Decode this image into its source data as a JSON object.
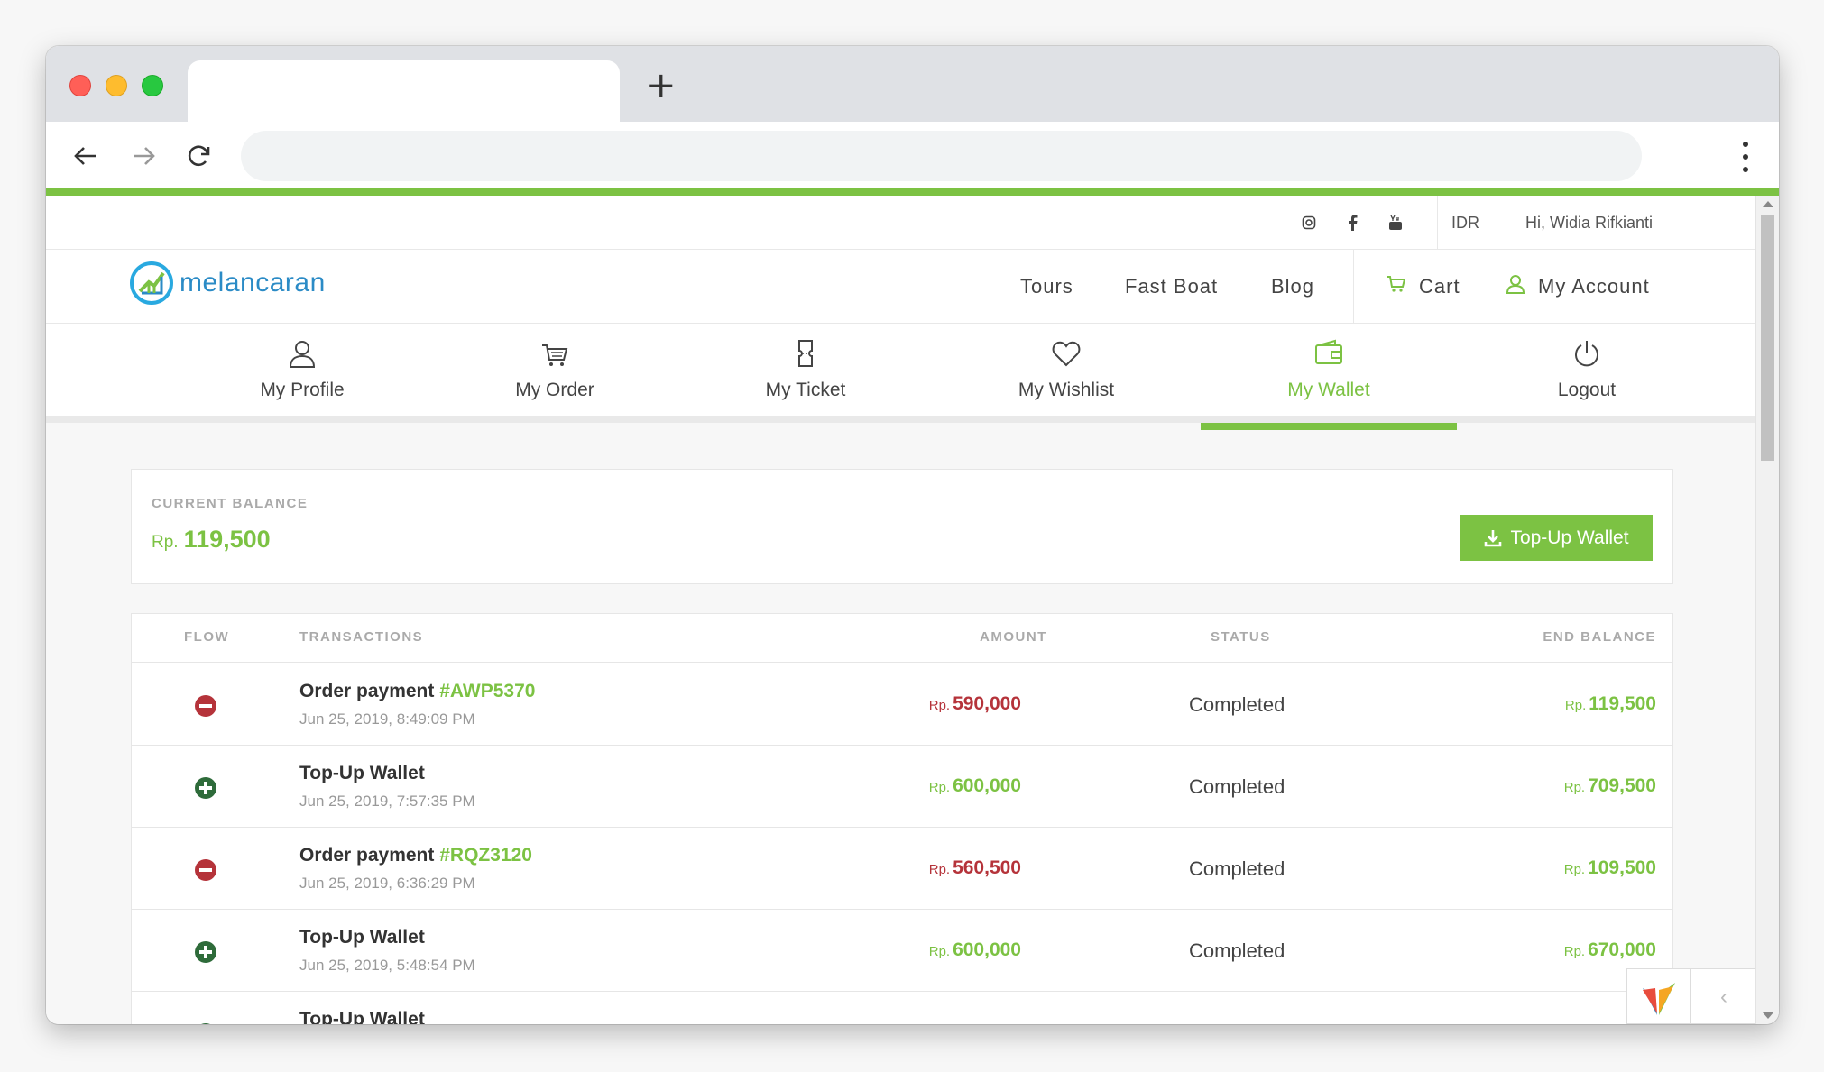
{
  "browser": {
    "new_tab_symbol": "+"
  },
  "topbar": {
    "currency": "IDR",
    "greeting": "Hi, Widia Rifkianti"
  },
  "brand": {
    "name": "melancaran"
  },
  "nav": {
    "links": [
      {
        "label": "Tours"
      },
      {
        "label": "Fast Boat"
      },
      {
        "label": "Blog"
      }
    ],
    "cart": "Cart",
    "account": "My Account"
  },
  "account_menu": [
    {
      "label": "My Profile",
      "icon": "user-icon"
    },
    {
      "label": "My Order",
      "icon": "cart-icon"
    },
    {
      "label": "My Ticket",
      "icon": "ticket-icon"
    },
    {
      "label": "My Wishlist",
      "icon": "heart-icon"
    },
    {
      "label": "My Wallet",
      "icon": "wallet-icon",
      "active": true
    },
    {
      "label": "Logout",
      "icon": "power-icon"
    }
  ],
  "balance": {
    "label": "CURRENT BALANCE",
    "currency": "Rp.",
    "amount": "119,500",
    "topup_label": "Top-Up Wallet"
  },
  "table": {
    "headers": {
      "flow": "FLOW",
      "transactions": "TRANSACTIONS",
      "amount": "AMOUNT",
      "status": "STATUS",
      "end_balance": "END BALANCE"
    },
    "rows": [
      {
        "flow": "out",
        "title": "Order payment",
        "order": "#AWP5370",
        "date": "Jun 25, 2019, 8:49:09 PM",
        "cur": "Rp.",
        "amount": "590,000",
        "status": "Completed",
        "end_cur": "Rp.",
        "end_balance": "119,500"
      },
      {
        "flow": "in",
        "title": "Top-Up Wallet",
        "order": "",
        "date": "Jun 25, 2019, 7:57:35 PM",
        "cur": "Rp.",
        "amount": "600,000",
        "status": "Completed",
        "end_cur": "Rp.",
        "end_balance": "709,500"
      },
      {
        "flow": "out",
        "title": "Order payment",
        "order": "#RQZ3120",
        "date": "Jun 25, 2019, 6:36:29 PM",
        "cur": "Rp.",
        "amount": "560,500",
        "status": "Completed",
        "end_cur": "Rp.",
        "end_balance": "109,500"
      },
      {
        "flow": "in",
        "title": "Top-Up Wallet",
        "order": "",
        "date": "Jun 25, 2019, 5:48:54 PM",
        "cur": "Rp.",
        "amount": "600,000",
        "status": "Completed",
        "end_cur": "Rp.",
        "end_balance": "670,000"
      },
      {
        "flow": "in",
        "title": "Top-Up Wallet",
        "order": "",
        "date": "",
        "cur": "",
        "amount": "",
        "status": "",
        "end_cur": "",
        "end_balance": ""
      }
    ]
  },
  "colors": {
    "accent": "#7cc243",
    "negative": "#b5333a",
    "positive_icon": "#2e6b3a",
    "brand_blue": "#2b8bc6"
  }
}
